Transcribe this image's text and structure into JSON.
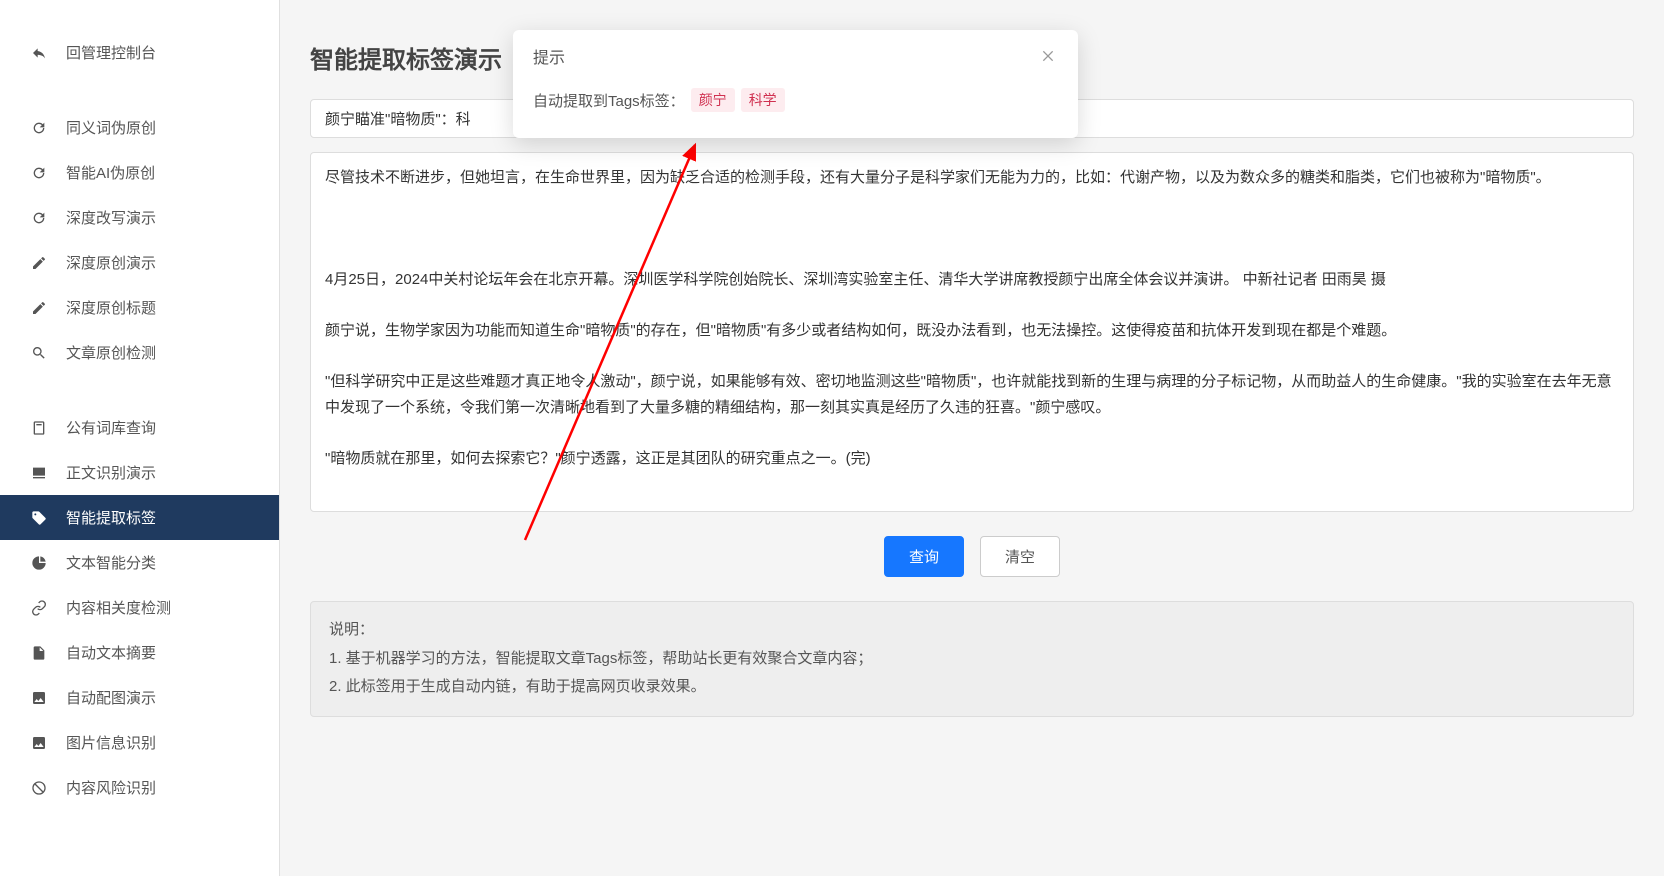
{
  "sidebar": {
    "back": "回管理控制台",
    "items1": [
      {
        "label": "同义词伪原创"
      },
      {
        "label": "智能AI伪原创"
      },
      {
        "label": "深度改写演示"
      },
      {
        "label": "深度原创演示"
      },
      {
        "label": "深度原创标题"
      },
      {
        "label": "文章原创检测"
      }
    ],
    "items2": [
      {
        "label": "公有词库查询"
      },
      {
        "label": "正文识别演示"
      },
      {
        "label": "智能提取标签"
      },
      {
        "label": "文本智能分类"
      },
      {
        "label": "内容相关度检测"
      },
      {
        "label": "自动文本摘要"
      },
      {
        "label": "自动配图演示"
      },
      {
        "label": "图片信息识别"
      },
      {
        "label": "内容风险识别"
      }
    ]
  },
  "page": {
    "title": "智能提取标签演示",
    "input_value": "颜宁瞄准\"暗物质\"：科",
    "textarea_value": "尽管技术不断进步，但她坦言，在生命世界里，因为缺乏合适的检测手段，还有大量分子是科学家们无能为力的，比如：代谢产物，以及为数众多的糖类和脂类，它们也被称为\"暗物质\"。\n\n\n\n4月25日，2024中关村论坛年会在北京开幕。深圳医学科学院创始院长、深圳湾实验室主任、清华大学讲席教授颜宁出席全体会议并演讲。 中新社记者 田雨昊 摄\n\n颜宁说，生物学家因为功能而知道生命\"暗物质\"的存在，但\"暗物质\"有多少或者结构如何，既没办法看到，也无法操控。这使得疫苗和抗体开发到现在都是个难题。\n\n\"但科学研究中正是这些难题才真正地令人激动\"，颜宁说，如果能够有效、密切地监测这些\"暗物质\"，也许就能找到新的生理与病理的分子标记物，从而助益人的生命健康。\"我的实验室在去年无意中发现了一个系统，令我们第一次清晰地看到了大量多糖的精细结构，那一刻其实真是经历了久违的狂喜。\"颜宁感叹。\n\n\"暗物质就在那里，如何去探索它？\"颜宁透露，这正是其团队的研究重点之一。(完)",
    "query_btn": "查询",
    "clear_btn": "清空"
  },
  "info": {
    "heading": "说明：",
    "line1": "1. 基于机器学习的方法，智能提取文章Tags标签，帮助站长更有效聚合文章内容；",
    "line2": "2. 此标签用于生成自动内链，有助于提高网页收录效果。"
  },
  "modal": {
    "title": "提示",
    "text": "自动提取到Tags标签：",
    "tag1": "颜宁",
    "tag2": "科学"
  }
}
